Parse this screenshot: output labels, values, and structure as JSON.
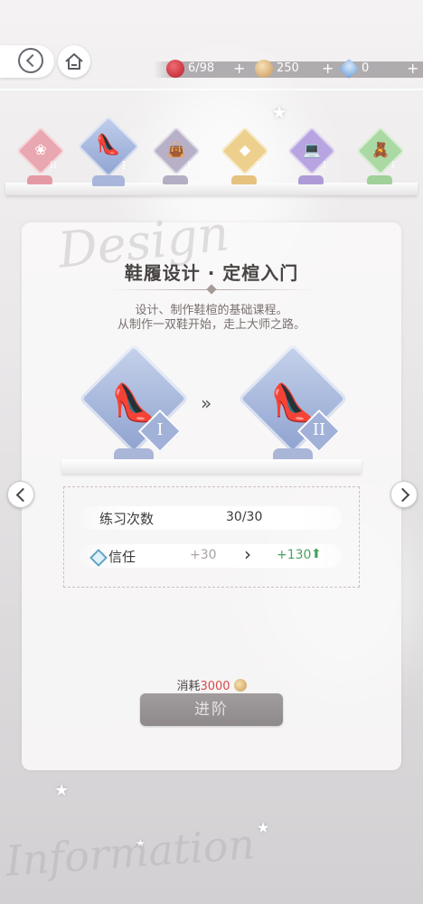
{
  "topbar": {
    "resources": [
      {
        "icon": "apple-icon",
        "value": "6/98",
        "color": "#d0343f"
      },
      {
        "icon": "coin-icon",
        "value": "250",
        "color": "#d2a66a"
      },
      {
        "icon": "diamond-icon",
        "value": "0",
        "color": "#8cb4e2"
      }
    ],
    "plus": "+"
  },
  "categories": [
    {
      "name": "clothing",
      "icon": "dress-icon",
      "glyph": "❀",
      "level": "II",
      "color": "#e9a7b1",
      "base": "#e49aa5"
    },
    {
      "name": "shoes",
      "icon": "high-heel-icon",
      "glyph": "👠",
      "level": "I",
      "color": "#9fb1dc",
      "base": "#a8b6dc",
      "selected": true
    },
    {
      "name": "bags",
      "icon": "handbag-icon",
      "glyph": "👜",
      "level": "I",
      "color": "#b7b0c7",
      "base": "#b4aec4"
    },
    {
      "name": "jewelry",
      "icon": "gem-icon",
      "glyph": "◆",
      "level": "I",
      "color": "#eed08e",
      "base": "#e5c27e"
    },
    {
      "name": "electronics",
      "icon": "laptop-icon",
      "glyph": "💻",
      "level": "I",
      "color": "#b7a4e1",
      "base": "#ad9bd8"
    },
    {
      "name": "toys",
      "icon": "teddy-bear-icon",
      "glyph": "🧸",
      "level": "I",
      "color": "#aad9a3",
      "base": "#9fd198"
    }
  ],
  "panel": {
    "title": "鞋履设计 · 定楦入门",
    "desc_line1": "设计、制作鞋楦的基础课程。",
    "desc_line2": "从制作一双鞋开始，走上大师之路。",
    "deco_top": "Design",
    "deco_bottom": "Information",
    "from_level": "I",
    "to_level": "II",
    "arrow": "»"
  },
  "stats": {
    "practice_label": "练习次数",
    "practice_value": "30/30",
    "trust_label": "信任",
    "trust_current": "+30",
    "trust_arrow": "›",
    "trust_next": "+130",
    "trust_up": "⬆"
  },
  "cost": {
    "label": "消耗",
    "amount": "3000"
  },
  "advance_button": "进阶"
}
